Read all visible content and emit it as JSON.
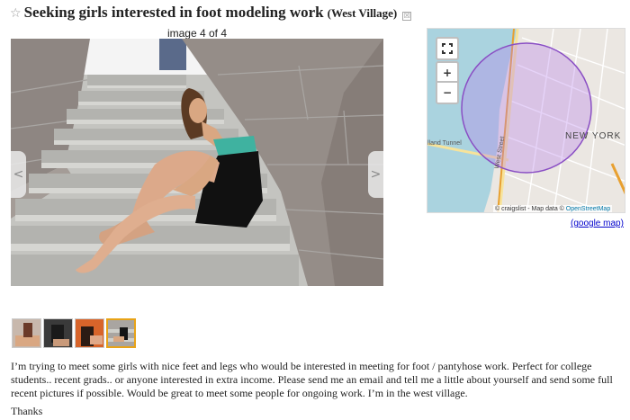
{
  "posting": {
    "star": "☆",
    "title": "Seeking girls interested in foot modeling work",
    "location": "(West Village)",
    "hide_icon": "☒"
  },
  "gallery": {
    "counter": "image 4 of 4",
    "prev_label": "<",
    "next_label": ">",
    "thumbnail_count": 4,
    "selected_index": 3
  },
  "map": {
    "zoom_in": "+",
    "zoom_out": "−",
    "fullscreen_icon": "fullscreen-icon",
    "city_label": "NEW YORK",
    "tunnel_label": "lland Tunnel",
    "street_label": "West Street",
    "attribution_prefix": "© craigslist - Map data © ",
    "attribution_link": "OpenStreetMap",
    "google_map_link": "(google map)"
  },
  "body": {
    "text": "I’m trying to meet some girls with nice feet and legs who would be interested in meeting for foot / pantyhose work. Perfect for college students.. recent grads.. or anyone interested in extra income. Please send me an email and tell me a little about yourself and send some full recent pictures if possible. Would be great to meet some people for ongoing work. I’m in the west village.",
    "closing": "Thanks"
  },
  "colors": {
    "selected_thumb_border": "#e8a317",
    "map_circle": "#8a4fc4",
    "link": "#0000cc"
  }
}
